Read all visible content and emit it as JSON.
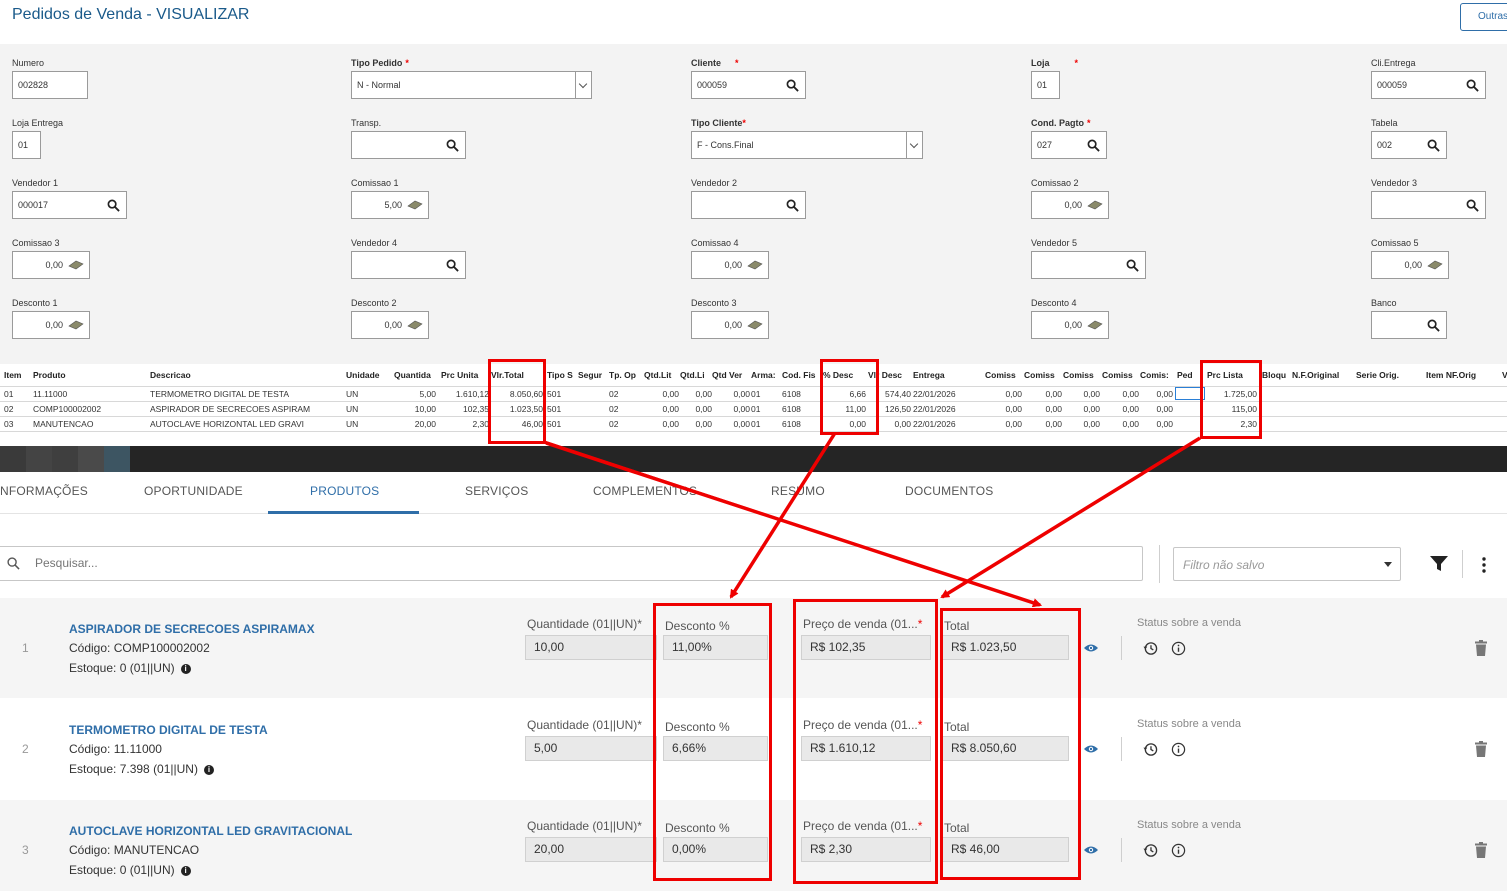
{
  "header": {
    "title": "Pedidos de Venda - VISUALIZAR",
    "outras_label": "Outras"
  },
  "form": {
    "numero": {
      "label": "Numero",
      "value": "002828"
    },
    "tipo_pedido": {
      "label": "Tipo Pedido",
      "value": "N - Normal"
    },
    "cliente": {
      "label": "Cliente",
      "value": "000059"
    },
    "loja": {
      "label": "Loja",
      "value": "01"
    },
    "cli_entrega": {
      "label": "Cli.Entrega",
      "value": "000059"
    },
    "loja_entrega": {
      "label": "Loja Entrega",
      "value": "01"
    },
    "transp": {
      "label": "Transp.",
      "value": ""
    },
    "tipo_cliente": {
      "label": "Tipo Cliente",
      "value": "F - Cons.Final"
    },
    "cond_pagto": {
      "label": "Cond. Pagto",
      "value": "027"
    },
    "tabela": {
      "label": "Tabela",
      "value": "002"
    },
    "vendedor1": {
      "label": "Vendedor 1",
      "value": "000017"
    },
    "comissao1": {
      "label": "Comissao 1",
      "value": "5,00"
    },
    "vendedor2": {
      "label": "Vendedor 2",
      "value": ""
    },
    "comissao2": {
      "label": "Comissao 2",
      "value": "0,00"
    },
    "vendedor3": {
      "label": "Vendedor 3",
      "value": ""
    },
    "comissao3": {
      "label": "Comissao 3",
      "value": "0,00"
    },
    "vendedor4": {
      "label": "Vendedor 4",
      "value": ""
    },
    "comissao4": {
      "label": "Comissao 4",
      "value": "0,00"
    },
    "vendedor5": {
      "label": "Vendedor 5",
      "value": ""
    },
    "comissao5": {
      "label": "Comissao 5",
      "value": "0,00"
    },
    "desconto1": {
      "label": "Desconto 1",
      "value": "0,00"
    },
    "desconto2": {
      "label": "Desconto 2",
      "value": "0,00"
    },
    "desconto3": {
      "label": "Desconto 3",
      "value": "0,00"
    },
    "desconto4": {
      "label": "Desconto 4",
      "value": "0,00"
    },
    "banco": {
      "label": "Banco",
      "value": ""
    }
  },
  "grid": {
    "headers": [
      "Item",
      "Produto",
      "Descricao",
      "Unidade",
      "Quantida",
      "Prc Unita",
      "Vlr.Total",
      "Tipo S",
      "Segur",
      "Tp. Op",
      "Qtd.Lit",
      "Qtd.Li",
      "Qtd Ver",
      "Arma:",
      "Cod. Fis",
      "% Desc",
      "Vlr Desc",
      "Entrega",
      "Comiss",
      "Comiss",
      "Comiss",
      "Comiss",
      "Comis:",
      "Ped",
      "Prc Lista",
      "Bloqu",
      "N.F.Original",
      "Serie Orig.",
      "Item NF.Orig",
      "V"
    ],
    "rows": [
      [
        "01",
        "11.11000",
        "TERMOMETRO DIGITAL DE TESTA",
        "UN",
        "5,00",
        "1.610,12",
        "8.050,60",
        "501",
        "",
        "02",
        "0,00",
        "0,00",
        "0,00",
        "01",
        "6108",
        "6,66",
        "574,40",
        "22/01/2026",
        "0,00",
        "0,00",
        "0,00",
        "0,00",
        "0,00",
        "",
        "1.725,00"
      ],
      [
        "02",
        "COMP100002002",
        "ASPIRADOR DE SECRECOES ASPIRAM",
        "UN",
        "10,00",
        "102,35",
        "1.023,50",
        "501",
        "",
        "02",
        "0,00",
        "0,00",
        "0,00",
        "01",
        "6108",
        "11,00",
        "126,50",
        "22/01/2026",
        "0,00",
        "0,00",
        "0,00",
        "0,00",
        "0,00",
        "",
        "115,00"
      ],
      [
        "03",
        "MANUTENCAO",
        "AUTOCLAVE HORIZONTAL LED GRAVI",
        "UN",
        "20,00",
        "2,30",
        "46,00",
        "501",
        "",
        "02",
        "0,00",
        "0,00",
        "0,00",
        "01",
        "6108",
        "0,00",
        "0,00",
        "22/01/2026",
        "0,00",
        "0,00",
        "0,00",
        "0,00",
        "0,00",
        "",
        "2,30"
      ]
    ]
  },
  "tabs": [
    "NFORMAÇÕES",
    "OPORTUNIDADE",
    "PRODUTOS",
    "SERVIÇOS",
    "COMPLEMENTOS",
    "RESUMO",
    "DOCUMENTOS"
  ],
  "active_tab": "PRODUTOS",
  "search": {
    "placeholder": "Pesquisar..."
  },
  "filter": {
    "value": "Filtro não salvo"
  },
  "products": [
    {
      "index": "1",
      "name": "ASPIRADOR DE SECRECOES ASPIRAMAX",
      "codigo": "Código: COMP100002002",
      "estoque": "Estoque: 0 (01||UN)",
      "qty_label": "Quantidade (01||UN)*",
      "qty": "10,00",
      "desc_label": "Desconto %",
      "desc": "11,00%",
      "price_label": "Preço de venda (01...",
      "price": "R$ 102,35",
      "total_label": "Total",
      "total": "R$ 1.023,50",
      "status_label": "Status sobre a venda"
    },
    {
      "index": "2",
      "name": "TERMOMETRO DIGITAL DE TESTA",
      "codigo": "Código: 11.11000",
      "estoque": "Estoque: 7.398 (01||UN)",
      "qty_label": "Quantidade (01||UN)*",
      "qty": "5,00",
      "desc_label": "Desconto %",
      "desc": "6,66%",
      "price_label": "Preço de venda (01...",
      "price": "R$ 1.610,12",
      "total_label": "Total",
      "total": "R$ 8.050,60",
      "status_label": "Status sobre a venda"
    },
    {
      "index": "3",
      "name": "AUTOCLAVE HORIZONTAL LED GRAVITACIONAL",
      "codigo": "Código: MANUTENCAO",
      "estoque": "Estoque: 0 (01||UN)",
      "qty_label": "Quantidade (01||UN)*",
      "qty": "20,00",
      "desc_label": "Desconto %",
      "desc": "0,00%",
      "price_label": "Preço de venda (01...",
      "price": "R$ 2,30",
      "total_label": "Total",
      "total": "R$ 46,00",
      "status_label": "Status sobre a venda"
    }
  ],
  "colors": {
    "accent": "#2f6ea8",
    "highlight": "#e00000",
    "strip": "#2b2b2b"
  }
}
